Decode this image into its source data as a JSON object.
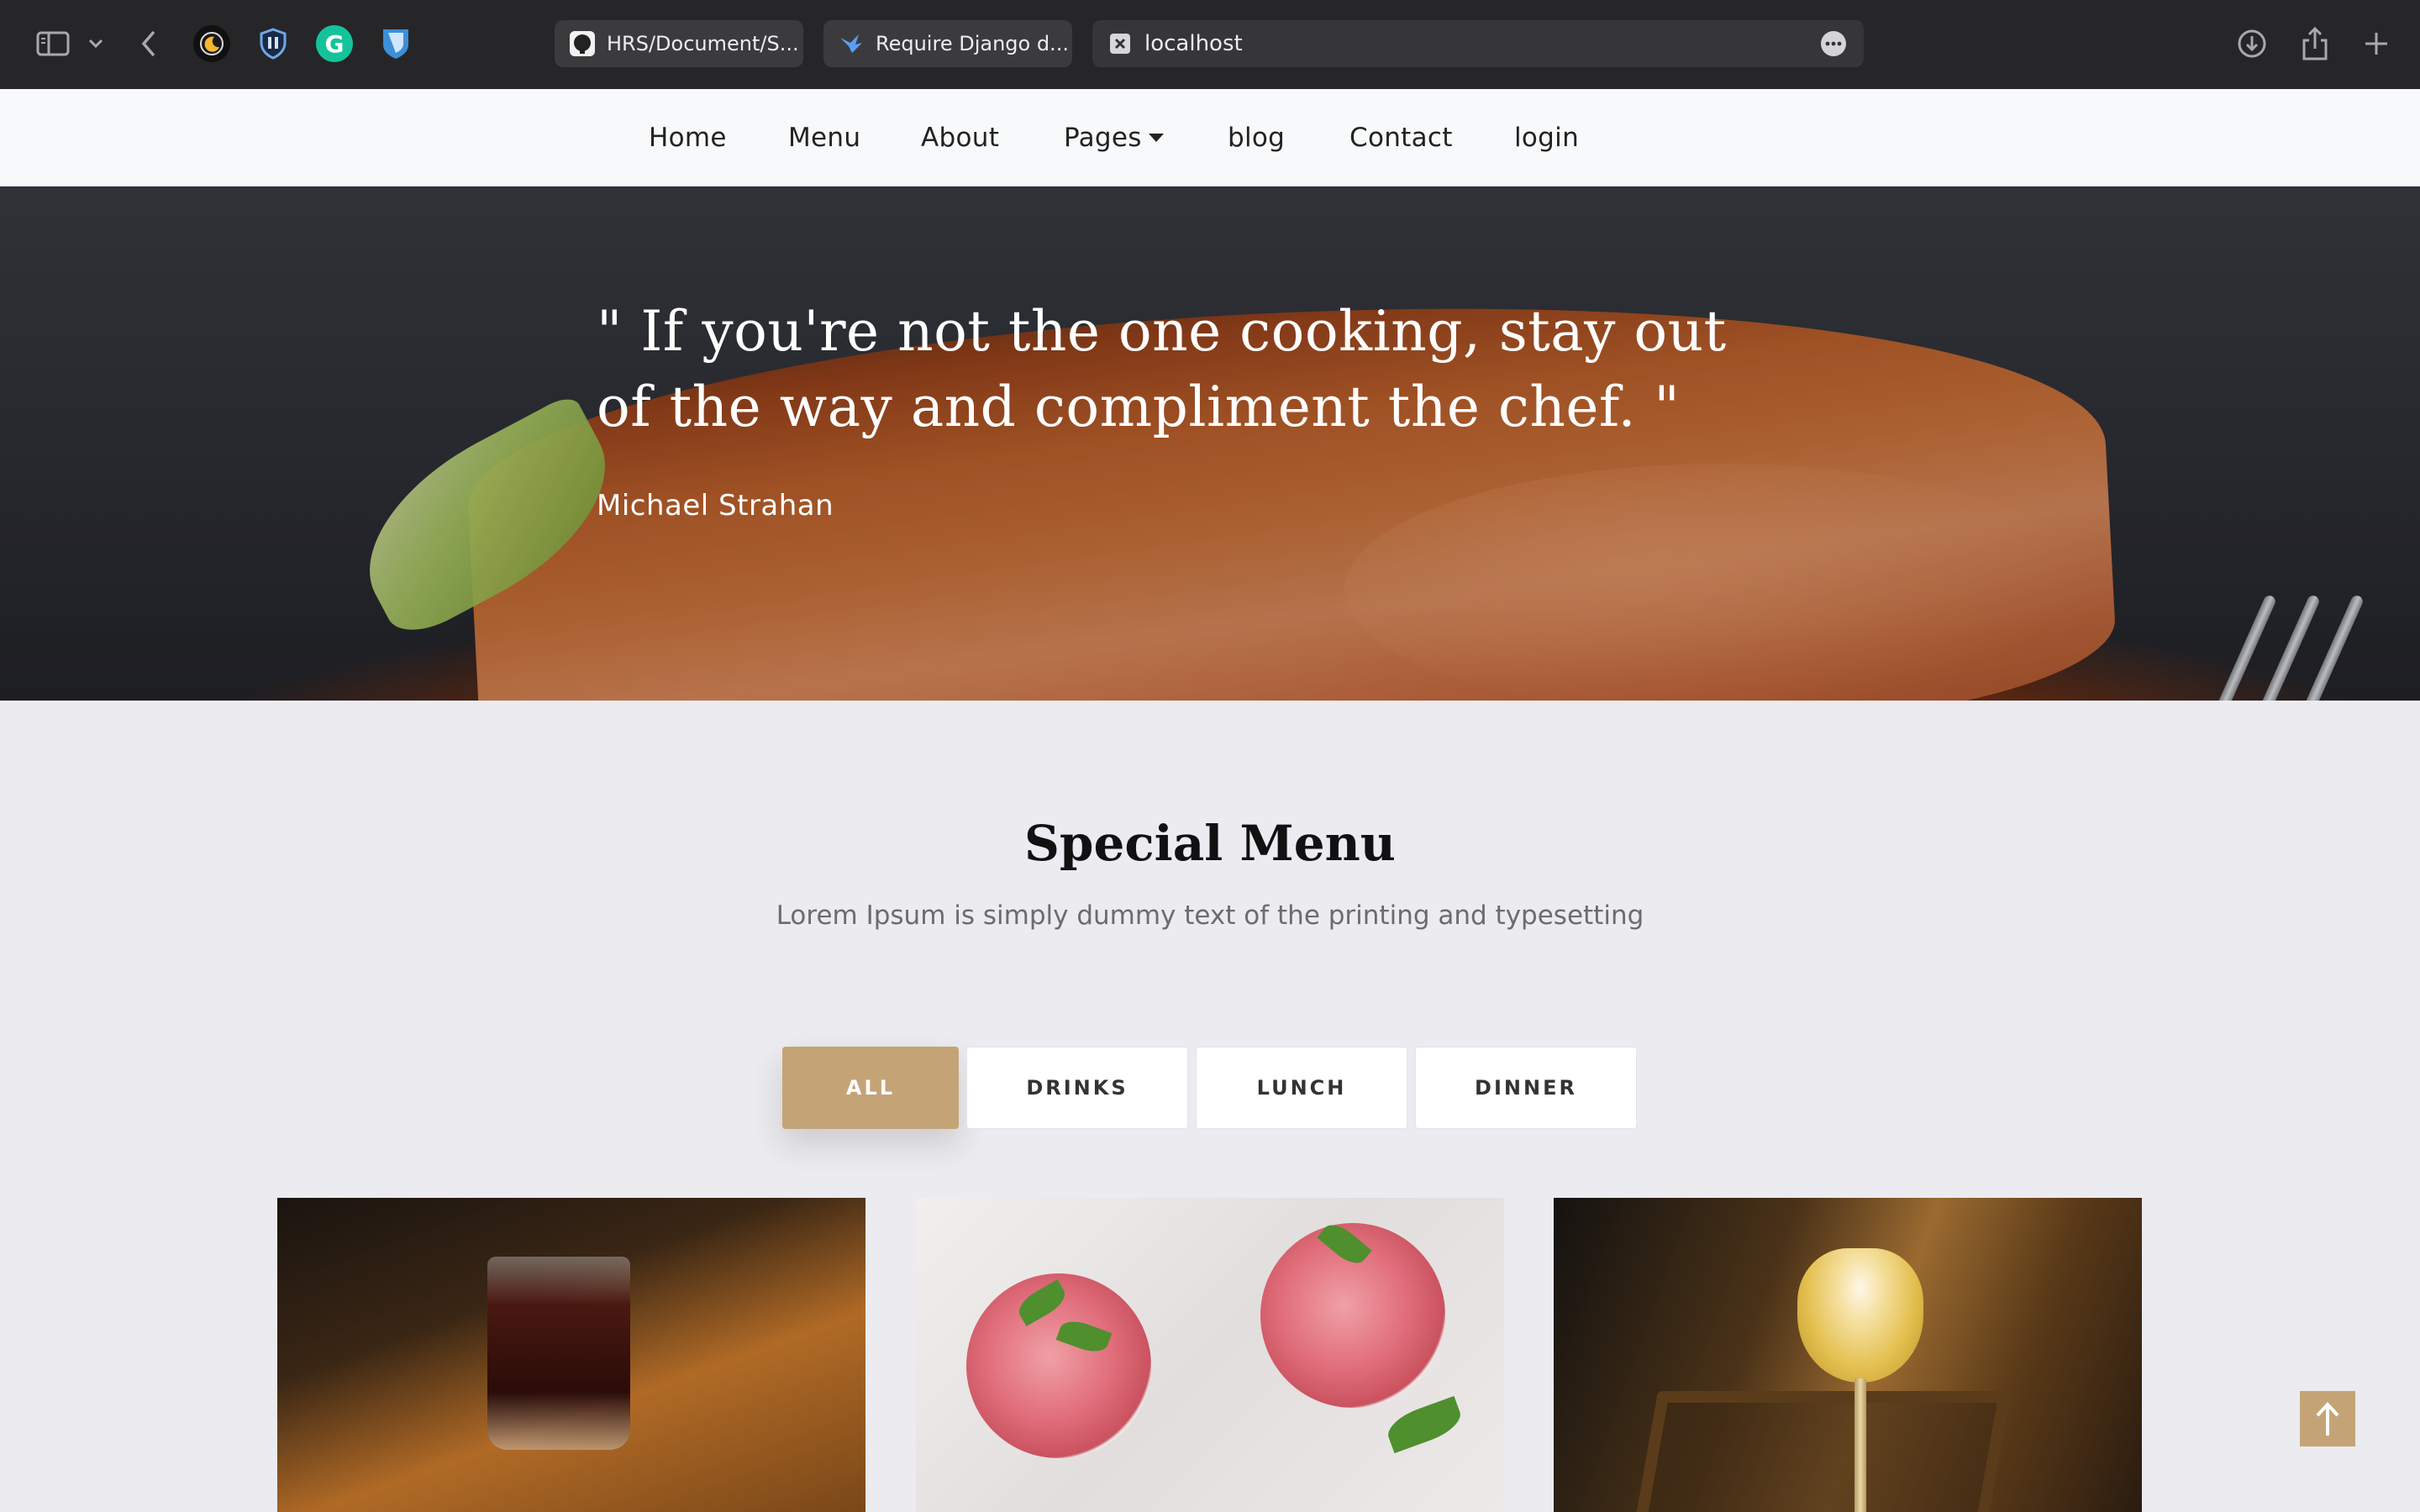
{
  "browser": {
    "tabs": [
      {
        "label": "HRS/Document/S...",
        "icon": "github-icon"
      },
      {
        "label": "Require Django d...",
        "icon": "bird-icon"
      }
    ],
    "address": "localhost"
  },
  "nav": {
    "items": [
      {
        "label": "Home"
      },
      {
        "label": "Menu"
      },
      {
        "label": "About"
      },
      {
        "label": "Pages"
      },
      {
        "label": "blog"
      },
      {
        "label": "Contact"
      },
      {
        "label": "login"
      }
    ]
  },
  "hero": {
    "quote_line1": "\" If you're not the one cooking, stay out",
    "quote_line2": "of the way and compliment the chef. \"",
    "author": "Michael Strahan"
  },
  "special": {
    "title": "Special Menu",
    "subtitle": "Lorem Ipsum is simply dummy text of the printing and typesetting",
    "filters": [
      {
        "label": "ALL",
        "active": true
      },
      {
        "label": "DRINKS",
        "active": false
      },
      {
        "label": "LUNCH",
        "active": false
      },
      {
        "label": "DINNER",
        "active": false
      }
    ]
  },
  "colors": {
    "accent": "#c4a476",
    "chrome_bg": "#262628",
    "page_bg": "#ebebf0"
  }
}
